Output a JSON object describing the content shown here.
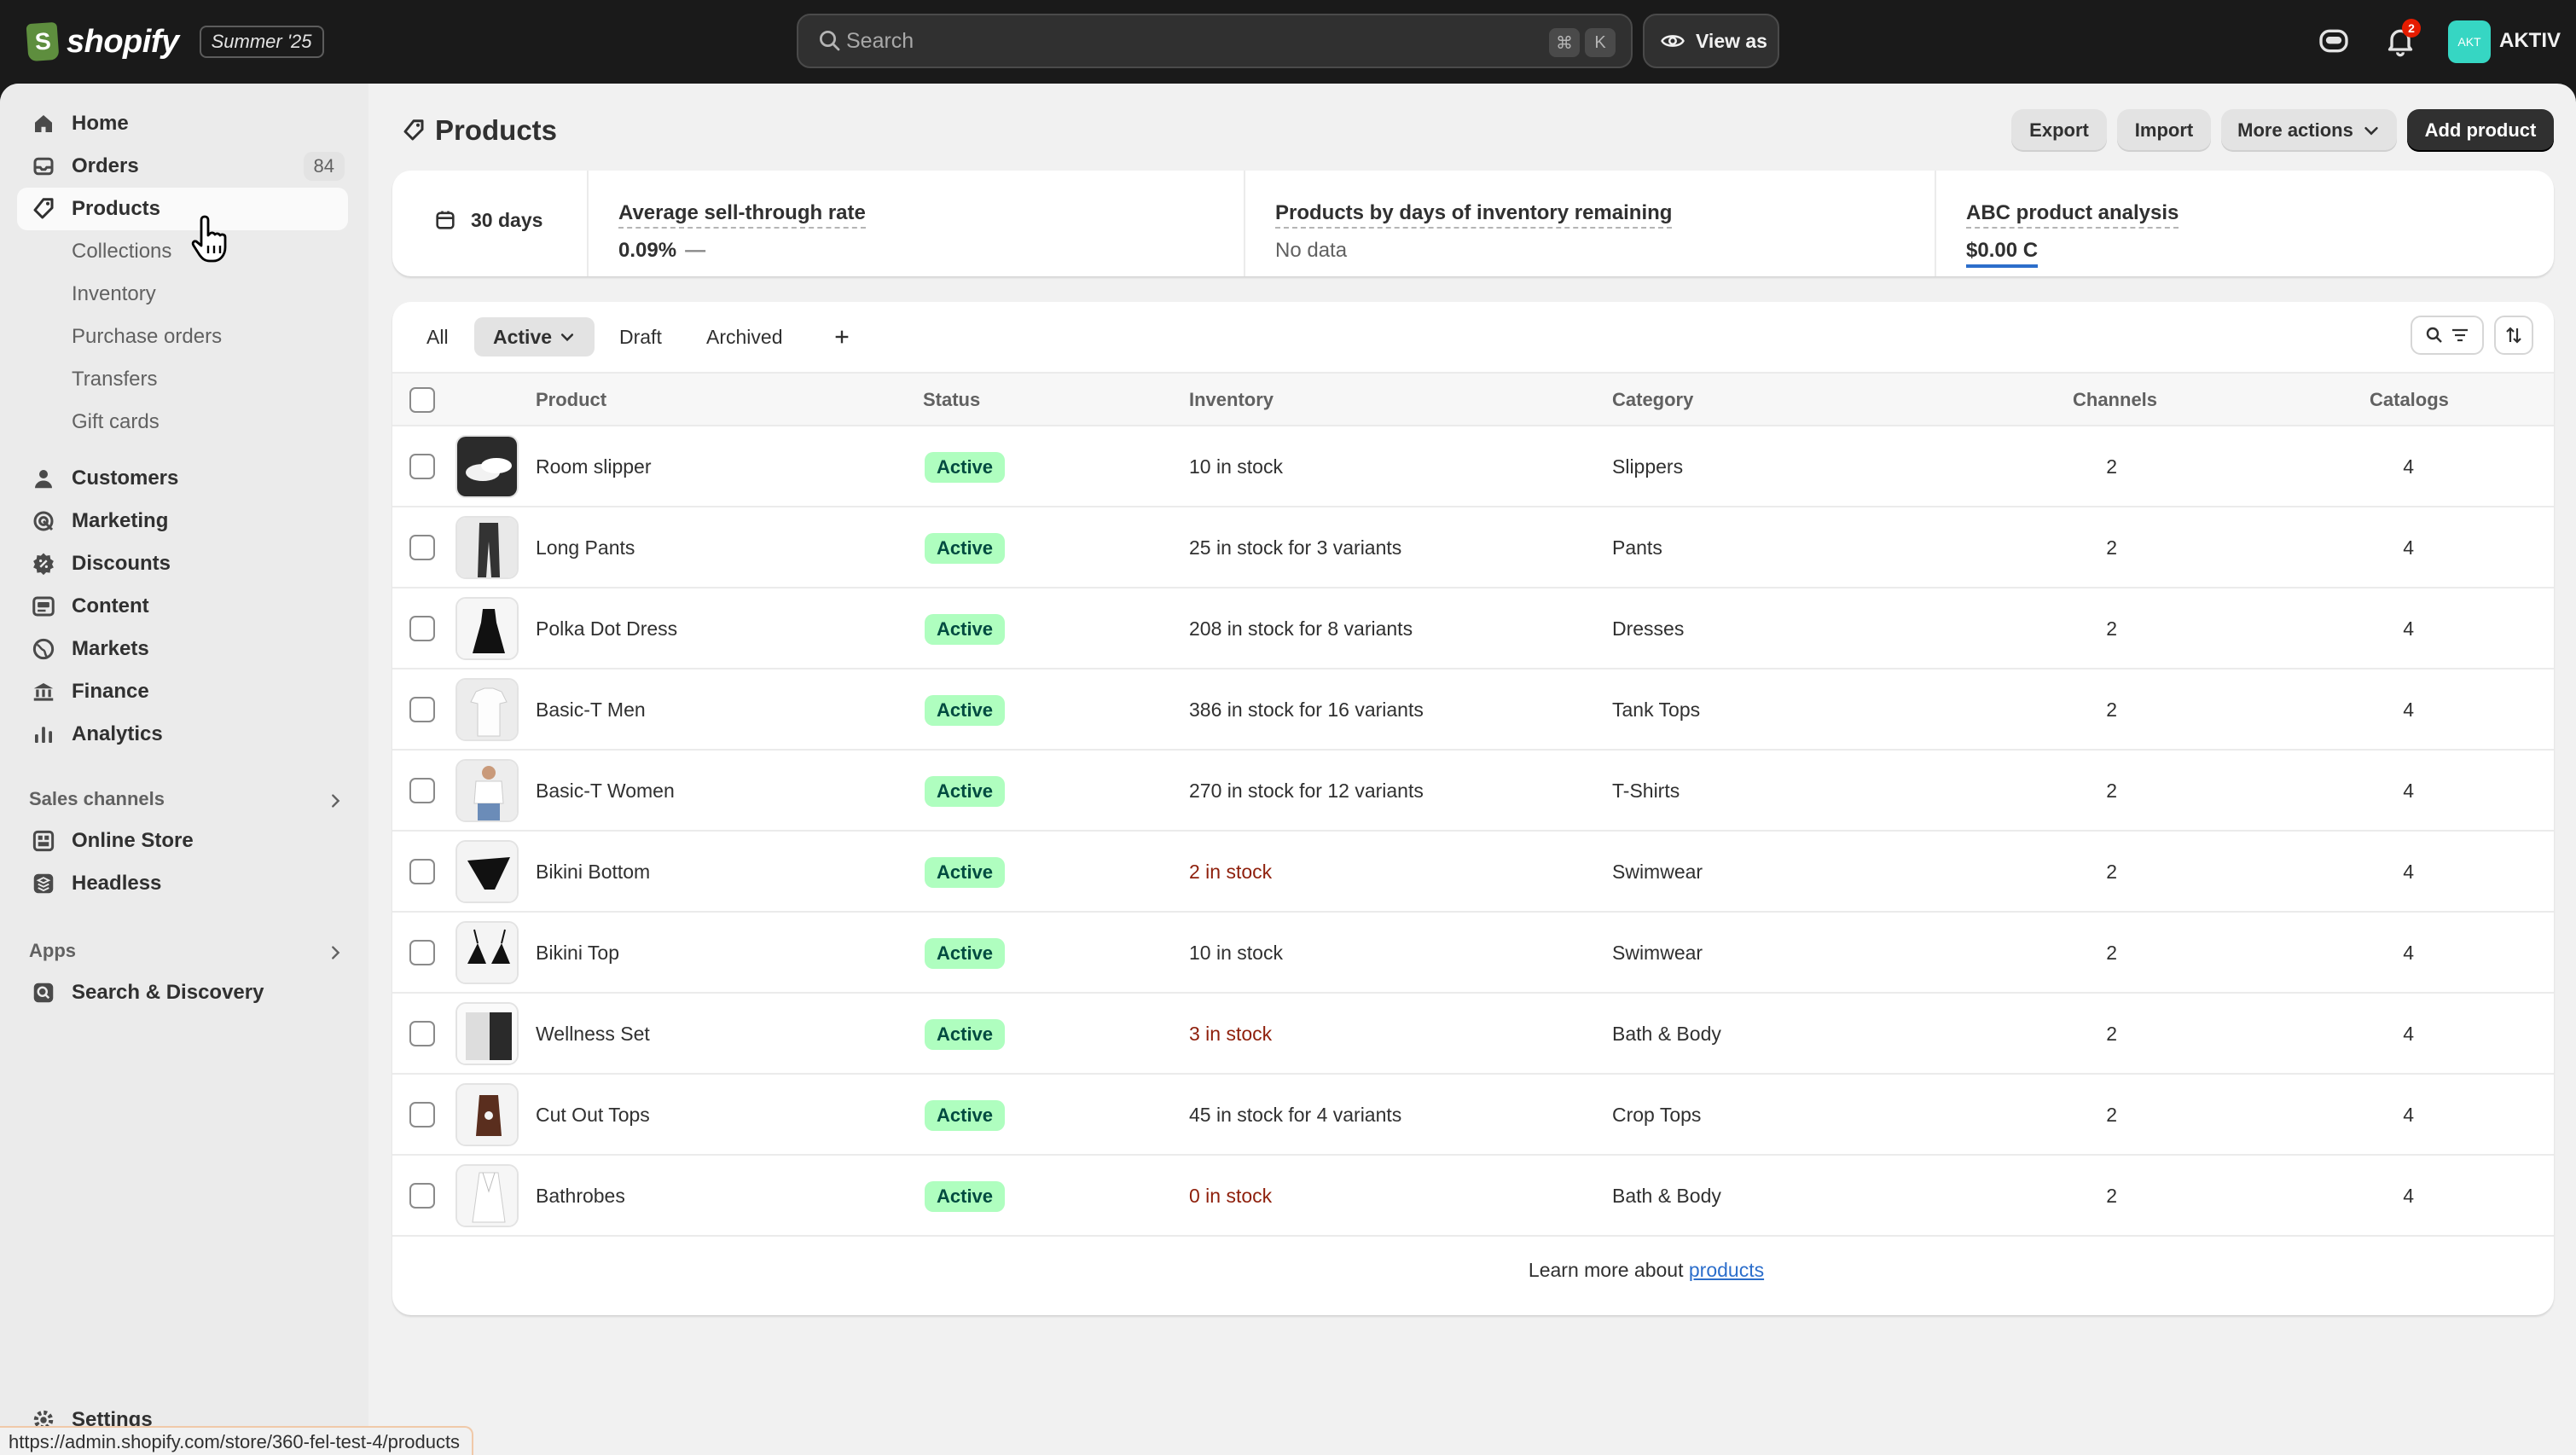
{
  "topbar": {
    "brand": "shopify",
    "edition": "Summer '25",
    "search_placeholder": "Search",
    "shortcut_key1": "⌘",
    "shortcut_key2": "K",
    "view_as": "View as",
    "notification_count": "2",
    "avatar_initials": "AKT",
    "store_name": "AKTIV"
  },
  "sidebar": {
    "primary": [
      {
        "label": "Home",
        "icon": "home-icon"
      },
      {
        "label": "Orders",
        "icon": "inbox-icon",
        "count": "84"
      },
      {
        "label": "Products",
        "icon": "tag-icon",
        "active": true
      }
    ],
    "products_sub": [
      "Collections",
      "Inventory",
      "Purchase orders",
      "Transfers",
      "Gift cards"
    ],
    "secondary": [
      {
        "label": "Customers",
        "icon": "person-icon"
      },
      {
        "label": "Marketing",
        "icon": "target-icon"
      },
      {
        "label": "Discounts",
        "icon": "discount-icon"
      },
      {
        "label": "Content",
        "icon": "content-icon"
      },
      {
        "label": "Markets",
        "icon": "globe-icon"
      },
      {
        "label": "Finance",
        "icon": "bank-icon"
      },
      {
        "label": "Analytics",
        "icon": "chart-icon"
      }
    ],
    "sales_channels_heading": "Sales channels",
    "sales_channels": [
      {
        "label": "Online Store",
        "icon": "store-icon"
      },
      {
        "label": "Headless",
        "icon": "headless-icon"
      }
    ],
    "apps_heading": "Apps",
    "apps": [
      {
        "label": "Search & Discovery",
        "icon": "search-discovery-icon"
      }
    ],
    "settings": "Settings"
  },
  "page": {
    "title": "Products",
    "actions": {
      "export": "Export",
      "import": "Import",
      "more_actions": "More actions",
      "add_product": "Add product"
    }
  },
  "metrics": {
    "date_range": "30 days",
    "sell_through_title": "Average sell-through rate",
    "sell_through_value": "0.09%",
    "sell_through_trend": "—",
    "days_inventory_title": "Products by days of inventory remaining",
    "days_inventory_value": "No data",
    "abc_title": "ABC product analysis",
    "abc_value": "$0.00 C"
  },
  "tabs": [
    "All",
    "Active",
    "Draft",
    "Archived"
  ],
  "table": {
    "headers": {
      "product": "Product",
      "status": "Status",
      "inventory": "Inventory",
      "category": "Category",
      "channels": "Channels",
      "catalogs": "Catalogs"
    },
    "rows": [
      {
        "product": "Room slipper",
        "status": "Active",
        "inventory": "10 in stock",
        "low": false,
        "category": "Slippers",
        "channels": "2",
        "catalogs": "4"
      },
      {
        "product": "Long Pants",
        "status": "Active",
        "inventory": "25 in stock for 3 variants",
        "low": false,
        "category": "Pants",
        "channels": "2",
        "catalogs": "4"
      },
      {
        "product": "Polka Dot Dress",
        "status": "Active",
        "inventory": "208 in stock for 8 variants",
        "low": false,
        "category": "Dresses",
        "channels": "2",
        "catalogs": "4"
      },
      {
        "product": "Basic-T Men",
        "status": "Active",
        "inventory": "386 in stock for 16 variants",
        "low": false,
        "category": "Tank Tops",
        "channels": "2",
        "catalogs": "4"
      },
      {
        "product": "Basic-T Women",
        "status": "Active",
        "inventory": "270 in stock for 12 variants",
        "low": false,
        "category": "T-Shirts",
        "channels": "2",
        "catalogs": "4"
      },
      {
        "product": "Bikini Bottom",
        "status": "Active",
        "inventory": "2 in stock",
        "low": true,
        "category": "Swimwear",
        "channels": "2",
        "catalogs": "4"
      },
      {
        "product": "Bikini Top",
        "status": "Active",
        "inventory": "10 in stock",
        "low": false,
        "category": "Swimwear",
        "channels": "2",
        "catalogs": "4"
      },
      {
        "product": "Wellness Set",
        "status": "Active",
        "inventory": "3 in stock",
        "low": true,
        "category": "Bath & Body",
        "channels": "2",
        "catalogs": "4"
      },
      {
        "product": "Cut Out Tops",
        "status": "Active",
        "inventory": "45 in stock for 4 variants",
        "low": false,
        "category": "Crop Tops",
        "channels": "2",
        "catalogs": "4"
      },
      {
        "product": "Bathrobes",
        "status": "Active",
        "inventory": "0 in stock",
        "low": true,
        "category": "Bath & Body",
        "channels": "2",
        "catalogs": "4"
      }
    ]
  },
  "footer": {
    "learn_more": "Learn more about",
    "link": "products"
  },
  "statusbar_url": "https://admin.shopify.com/store/360-fel-test-4/products",
  "colors": {
    "topbar_bg": "#1a1a1a",
    "status_active_bg": "#affebf",
    "status_active_text": "#014b40",
    "low_stock_text": "#8e1f0b",
    "link": "#2c6ecb",
    "primary_button": "#303030"
  }
}
